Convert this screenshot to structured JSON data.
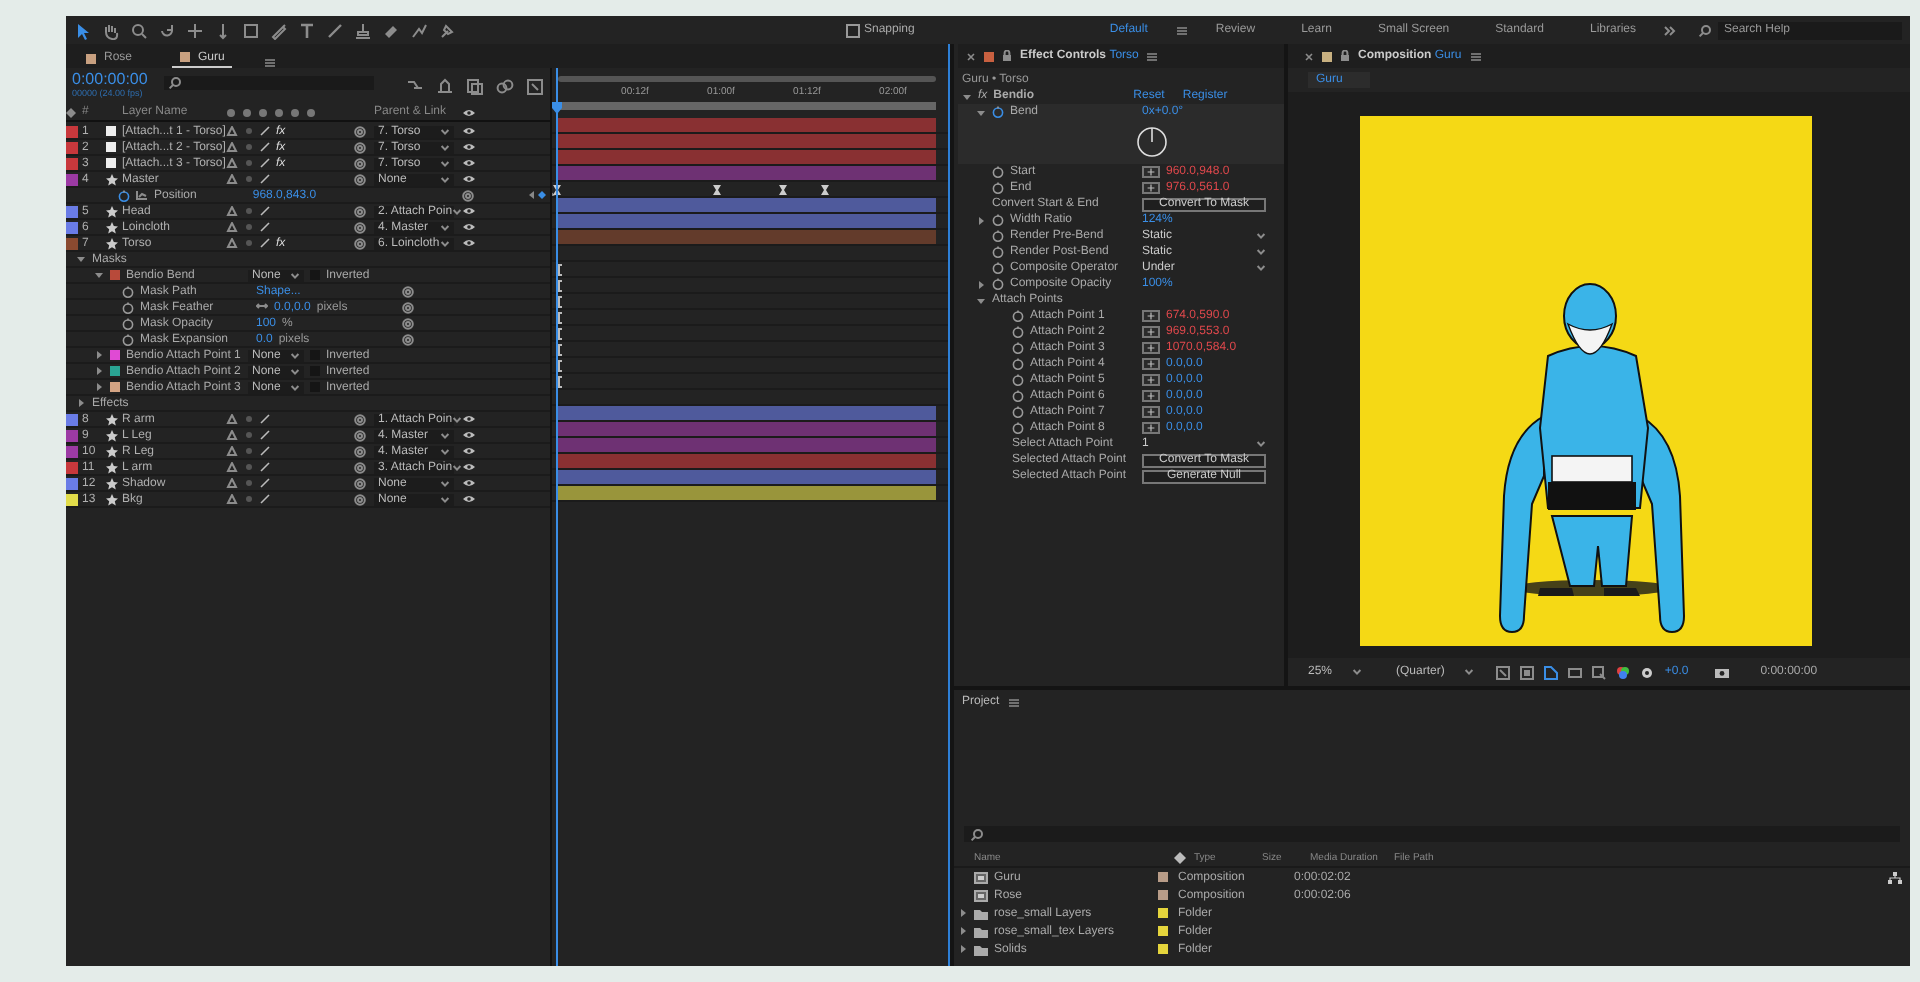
{
  "toolbar": {
    "snapping": {
      "label": "Snapping",
      "checked": false
    },
    "workspaces": [
      {
        "label": "Default",
        "selected": true
      },
      {
        "label": "Review",
        "selected": false
      },
      {
        "label": "Learn",
        "selected": false
      },
      {
        "label": "Small Screen",
        "selected": false
      },
      {
        "label": "Standard",
        "selected": false
      },
      {
        "label": "Libraries",
        "selected": false
      }
    ],
    "search": {
      "placeholder": "Search Help"
    }
  },
  "timeline": {
    "tabs": [
      {
        "label": "Rose",
        "selected": false
      },
      {
        "label": "Guru",
        "selected": true
      }
    ],
    "timecode": "0:00:00:00",
    "frame_info": "00000 (24.00 fps)",
    "columns": {
      "number": "#",
      "name": "Layer Name",
      "parent": "Parent & Link"
    },
    "ruler": [
      "00:12f",
      "01:00f",
      "01:12f",
      "02:00f"
    ],
    "rows": [
      {
        "kind": "solid",
        "number": "1",
        "color": "#c8383c",
        "name": "[Attach...t 1 - Torso]",
        "fx": "fx",
        "fx_on": true,
        "parent": "7. Torso"
      },
      {
        "kind": "solid",
        "number": "2",
        "color": "#c8383c",
        "name": "[Attach...t 2 - Torso]",
        "fx": "fx",
        "fx_on": true,
        "parent": "7. Torso"
      },
      {
        "kind": "solid",
        "number": "3",
        "color": "#c8383c",
        "name": "[Attach...t 3 - Torso]",
        "fx": "fx",
        "fx_on": true,
        "parent": "7. Torso"
      },
      {
        "kind": "shape",
        "number": "4",
        "color": "#9c3aa4",
        "name": "Master",
        "parent": "None"
      },
      {
        "kind": "property",
        "name": "Position",
        "value": "968.0,843.0",
        "keyframes": [
          {
            "level": 0.0
          },
          {
            "level": 0.43
          },
          {
            "level": 0.61
          },
          {
            "level": 0.72
          }
        ]
      },
      {
        "kind": "shape",
        "number": "5",
        "color": "#6a7ce6",
        "name": "Head",
        "parent": "2. Attach Poin"
      },
      {
        "kind": "shape",
        "number": "6",
        "color": "#6a7ce6",
        "name": "Loincloth",
        "parent": "4. Master"
      },
      {
        "kind": "shape",
        "number": "7",
        "color": "#8a4a30",
        "name": "Torso",
        "fx": "fx",
        "fx_on": true,
        "parent": "6. Loincloth"
      },
      {
        "kind": "group",
        "name": "Masks",
        "expanded": true
      },
      {
        "kind": "mask",
        "name": "Bendio Bend",
        "color": "#b84a3a",
        "expanded": true,
        "mode": "None",
        "inverted": "Inverted",
        "inverted_checked": false
      },
      {
        "kind": "mask-prop",
        "name": "Mask Path",
        "value": "Shape..."
      },
      {
        "kind": "mask-prop",
        "name": "Mask Feather",
        "value": "0.0,0.0",
        "unit": "pixels"
      },
      {
        "kind": "mask-prop",
        "name": "Mask Opacity",
        "value": "100",
        "unit": "%"
      },
      {
        "kind": "mask-prop",
        "name": "Mask Expansion",
        "value": "0.0",
        "unit": "pixels"
      },
      {
        "kind": "mask",
        "name": "Bendio Attach Point 1",
        "color": "#e04ad4",
        "expanded": false,
        "mode": "None",
        "inverted": "Inverted",
        "inverted_checked": false
      },
      {
        "kind": "mask",
        "name": "Bendio Attach Point 2",
        "color": "#2aa494",
        "expanded": false,
        "mode": "None",
        "inverted": "Inverted",
        "inverted_checked": false
      },
      {
        "kind": "mask",
        "name": "Bendio Attach Point 3",
        "color": "#d4a484",
        "expanded": false,
        "mode": "None",
        "inverted": "Inverted",
        "inverted_checked": false
      },
      {
        "kind": "group",
        "name": "Effects",
        "expanded": false
      },
      {
        "kind": "shape",
        "number": "8",
        "color": "#6a7ce6",
        "name": "R arm",
        "parent": "1. Attach Poin"
      },
      {
        "kind": "shape",
        "number": "9",
        "color": "#9c3aa4",
        "name": "L Leg",
        "parent": "4. Master"
      },
      {
        "kind": "shape",
        "number": "10",
        "color": "#9c3aa4",
        "name": "R Leg",
        "parent": "4. Master"
      },
      {
        "kind": "shape",
        "number": "11",
        "color": "#c8383c",
        "name": "L arm",
        "parent": "3. Attach Poin"
      },
      {
        "kind": "shape",
        "number": "12",
        "color": "#6a7ce6",
        "name": "Shadow",
        "parent": "None"
      },
      {
        "kind": "shape",
        "number": "13",
        "color": "#e2dc4a",
        "name": "Bkg",
        "parent": "None"
      }
    ]
  },
  "effect_controls": {
    "title": "Effect Controls",
    "layer": "Torso",
    "breadcrumb": "Guru • Torso",
    "effect": {
      "fx": "fx",
      "name": "Bendio",
      "expanded": true,
      "reset": "Reset",
      "register": "Register"
    },
    "bend": {
      "label": "Bend",
      "value": "0x+0.0°",
      "expanded": true
    },
    "rows": [
      {
        "kind": "point",
        "label": "Start",
        "value": "960.0,948.0",
        "color": "#e0484c"
      },
      {
        "kind": "point",
        "label": "End",
        "value": "976.0,561.0",
        "color": "#e0484c"
      },
      {
        "kind": "button",
        "label": "Convert Start & End",
        "button": "Convert To Mask"
      },
      {
        "kind": "number",
        "label": "Width Ratio",
        "value": "124%",
        "expanded": false
      },
      {
        "kind": "dropdown",
        "label": "Render Pre-Bend",
        "value": "Static"
      },
      {
        "kind": "dropdown",
        "label": "Render Post-Bend",
        "value": "Static"
      },
      {
        "kind": "dropdown",
        "label": "Composite Operator",
        "value": "Under"
      },
      {
        "kind": "number",
        "label": "Composite Opacity",
        "value": "100%",
        "expanded": false
      },
      {
        "kind": "group",
        "label": "Attach Points",
        "expanded": true,
        "children": [
          {
            "kind": "point",
            "label": "Attach Point 1",
            "value": "674.0,590.0",
            "color": "#e0484c"
          },
          {
            "kind": "point",
            "label": "Attach Point 2",
            "value": "969.0,553.0",
            "color": "#e0484c"
          },
          {
            "kind": "point",
            "label": "Attach Point 3",
            "value": "1070.0,584.0",
            "color": "#e0484c"
          },
          {
            "kind": "point",
            "label": "Attach Point 4",
            "value": "0.0,0.0",
            "color": "#3a8ee6"
          },
          {
            "kind": "point",
            "label": "Attach Point 5",
            "value": "0.0,0.0",
            "color": "#3a8ee6"
          },
          {
            "kind": "point",
            "label": "Attach Point 6",
            "value": "0.0,0.0",
            "color": "#3a8ee6"
          },
          {
            "kind": "point",
            "label": "Attach Point 7",
            "value": "0.0,0.0",
            "color": "#3a8ee6"
          },
          {
            "kind": "point",
            "label": "Attach Point 8",
            "value": "0.0,0.0",
            "color": "#3a8ee6"
          },
          {
            "kind": "menu",
            "label": "Select Attach Point",
            "value": "1"
          },
          {
            "kind": "button",
            "label": "Selected Attach Point",
            "button": "Convert To Mask"
          },
          {
            "kind": "button",
            "label": "Selected Attach Point",
            "button": "Generate Null"
          }
        ]
      }
    ]
  },
  "composition": {
    "title": "Composition",
    "name": "Guru",
    "tab": "Guru",
    "zoom": "25%",
    "resolution": "(Quarter)",
    "exposure": "+0.0",
    "timecode": "0:00:00:00"
  },
  "project": {
    "title": "Project",
    "columns": [
      "Name",
      "Type",
      "Size",
      "Media Duration",
      "File Path"
    ],
    "items": [
      {
        "kind": "comp",
        "name": "Guru",
        "color": "#b89c88",
        "type": "Composition",
        "duration": "0:00:02:02"
      },
      {
        "kind": "comp",
        "name": "Rose",
        "color": "#b89c88",
        "type": "Composition",
        "duration": "0:00:02:06"
      },
      {
        "kind": "folder",
        "name": "rose_small Layers",
        "color": "#e4d43c",
        "type": "Folder"
      },
      {
        "kind": "folder",
        "name": "rose_small_tex Layers",
        "color": "#e4d43c",
        "type": "Folder"
      },
      {
        "kind": "folder",
        "name": "Solids",
        "color": "#e4d43c",
        "type": "Folder"
      }
    ]
  }
}
